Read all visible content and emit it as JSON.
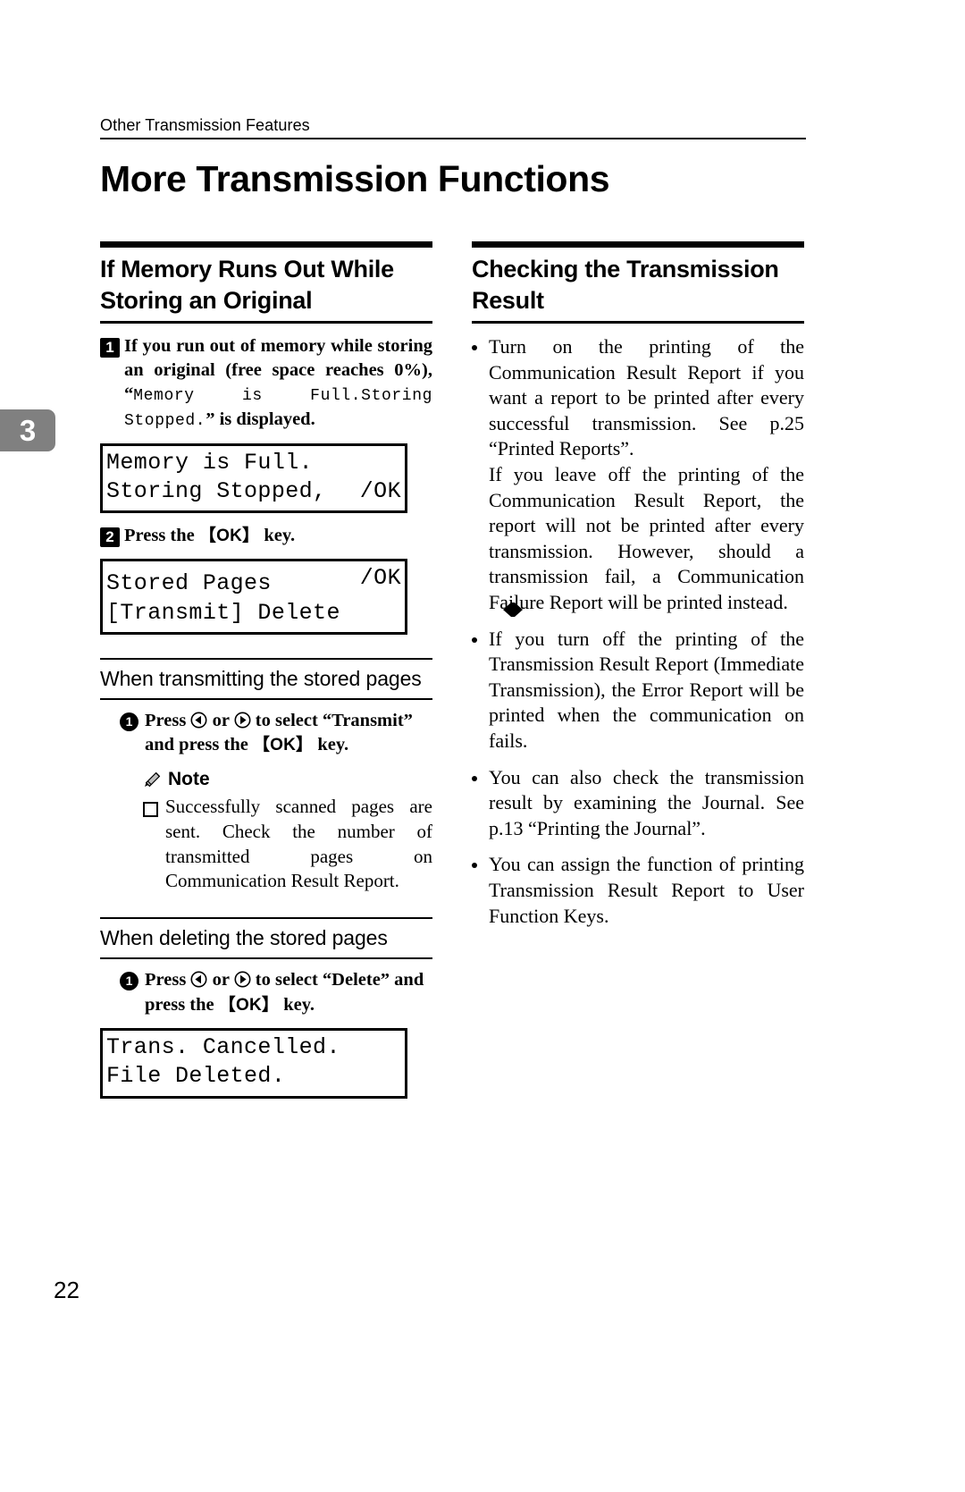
{
  "running_header": "Other Transmission Features",
  "page_title": "More Transmission Functions",
  "chapter_tab": "3",
  "folio": "22",
  "left_column": {
    "section_title": "If Memory Runs Out While Storing an Original",
    "step1": {
      "number": "1",
      "text_part1": "If you run out of memory while storing an original (free space reaches 0%), “",
      "text_mono": "Memory is Full.Storing Stopped.",
      "text_part2": "” is displayed."
    },
    "lcd1": {
      "line1_left": "Memory is Full.",
      "line1_right": "",
      "line2_left": "Storing Stopped,",
      "line2_right": "/OK"
    },
    "step2": {
      "number": "2",
      "text_before": "Press the ",
      "key": "【OK】",
      "text_after": " key."
    },
    "lcd2": {
      "line1_left": "Stored Pages",
      "line1_right": "/OK",
      "line1_arrows": "left-right-arrows",
      "line2_left": "[Transmit] Delete",
      "line2_right": ""
    },
    "subhead_transmit": "When transmitting the stored pages",
    "substep_transmit": {
      "number": "1",
      "text_before": "Press ",
      "icon_left": "circled-left-arrow",
      "text_mid1": " or ",
      "icon_right": "circled-right-arrow",
      "text_mid2": " to select “Transmit” and press the ",
      "key": "【OK】",
      "text_after": " key."
    },
    "note": {
      "icon": "pencil-icon",
      "label": "Note",
      "items": [
        "Successfully scanned pages are sent. Check the number of transmitted pages on Communication Result Report."
      ]
    },
    "subhead_delete": "When deleting the stored pages",
    "substep_delete": {
      "number": "1",
      "text_before": "Press ",
      "icon_left": "circled-left-arrow",
      "text_mid1": " or ",
      "icon_right": "circled-right-arrow",
      "text_mid2": " to select “Delete” and press the ",
      "key": "【OK】",
      "text_after": " key."
    },
    "lcd3": {
      "line1_left": "Trans. Cancelled.",
      "line1_right": "",
      "line2_left": "File Deleted.",
      "line2_right": ""
    }
  },
  "right_column": {
    "section_title": "Checking the Transmission Result",
    "bullets": [
      "Turn on the printing of the Communication Result Report if you want a report to be printed after every successful transmission. See p.25 “Printed Reports”.\nIf you leave off the printing of the Communication Result Report, the report will not be printed after every transmission. However, should a transmission fail, a Communication Failure Report will be printed instead.",
      "If you turn off the printing of the Transmission Result Report (Immediate Transmission), the Error Report will be printed when the communication on fails.",
      "You can also check the transmission result by examining the Journal. See p.13 “Printing the Journal”.",
      "You can assign the function of printing Transmission Result Report to User Function Keys."
    ]
  },
  "colors": {
    "tab_gray": "#808080",
    "ink": "#000000",
    "paper": "#ffffff"
  }
}
